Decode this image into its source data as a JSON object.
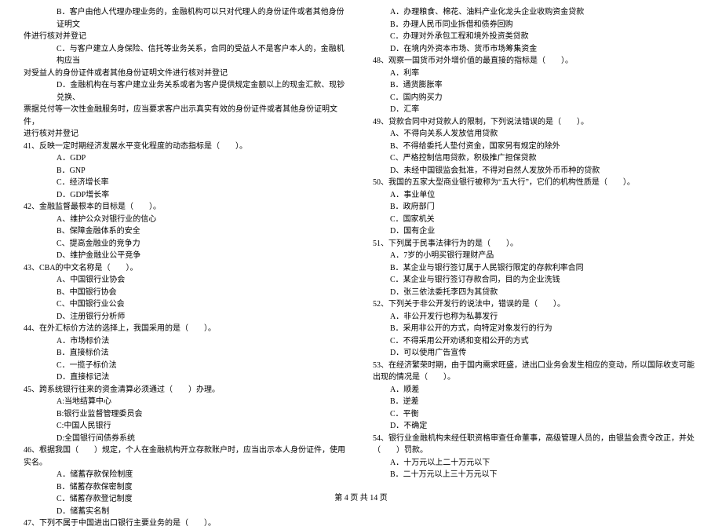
{
  "left": [
    {
      "cls": "i2",
      "t": "B．客户由他人代理办理业务的，金融机构可以只对代理人的身份证件或者其他身份证明文"
    },
    {
      "cls": "i0",
      "t": "件进行核对并登记"
    },
    {
      "cls": "i2",
      "t": "C．与客户建立人身保险、信托等业务关系，合同的受益人不是客户本人的，金融机构应当"
    },
    {
      "cls": "i0",
      "t": "对受益人的身份证件或者其他身份证明文件进行核对并登记"
    },
    {
      "cls": "i2",
      "t": "D．金融机构在与客户建立业务关系或者为客户提供规定金额以上的现金汇款、现钞兑换、"
    },
    {
      "cls": "i0",
      "t": "票据兑付等一次性金融服务时，应当要求客户出示真实有效的身份证件或者其他身份证明文件，"
    },
    {
      "cls": "i0",
      "t": "进行核对并登记"
    },
    {
      "cls": "i0",
      "t": "41、反映一定时期经济发展水平变化程度的动态指标是（　　）。"
    },
    {
      "cls": "i2",
      "t": "A．GDP"
    },
    {
      "cls": "i2",
      "t": "B．GNP"
    },
    {
      "cls": "i2",
      "t": "C．经济增长率"
    },
    {
      "cls": "i2",
      "t": "D．GDP增长率"
    },
    {
      "cls": "i0",
      "t": "42、金融监督最根本的目标是（　　）。"
    },
    {
      "cls": "i2",
      "t": "A、维护公众对银行业的信心"
    },
    {
      "cls": "i2",
      "t": "B、保障金融体系的安全"
    },
    {
      "cls": "i2",
      "t": "C、提高金融业的竞争力"
    },
    {
      "cls": "i2",
      "t": "D、维护金融业公平竞争"
    },
    {
      "cls": "i0",
      "t": "43、CBA的中文名称是（　　）。"
    },
    {
      "cls": "i2",
      "t": "A、中国银行业协会"
    },
    {
      "cls": "i2",
      "t": "B、中国银行协会"
    },
    {
      "cls": "i2",
      "t": "C、中国银行业公会"
    },
    {
      "cls": "i2",
      "t": "D、注册银行分析师"
    },
    {
      "cls": "i0",
      "t": "44、在外汇标价方法的选择上，我国采用的是（　　）。"
    },
    {
      "cls": "i2",
      "t": "A．市场标价法"
    },
    {
      "cls": "i2",
      "t": "B．直接标价法"
    },
    {
      "cls": "i2",
      "t": "C．一揽子标价法"
    },
    {
      "cls": "i2",
      "t": "D．直接标记法"
    },
    {
      "cls": "i0",
      "t": "45、跨系统银行往来的资金清算必须通过（　　）办理。"
    },
    {
      "cls": "i2",
      "t": "A:当地结算中心"
    },
    {
      "cls": "i2",
      "t": "B:银行业监督管理委员会"
    },
    {
      "cls": "i2",
      "t": "C:中国人民银行"
    },
    {
      "cls": "i2",
      "t": "D:全国银行间债券系统"
    },
    {
      "cls": "i0",
      "t": "46、根据我国（　　）规定，个人在金融机构开立存款账户时，应当出示本人身份证件，使用"
    },
    {
      "cls": "i0",
      "t": "实名。"
    },
    {
      "cls": "i2",
      "t": "A．储蓄存款保险制度"
    },
    {
      "cls": "i2",
      "t": "B．储蓄存款保密制度"
    },
    {
      "cls": "i2",
      "t": "C．储蓄存款登记制度"
    },
    {
      "cls": "i2",
      "t": "D．储蓄实名制"
    },
    {
      "cls": "i0",
      "t": "47、下列不属于中国进出口银行主要业务的是（　　）。"
    }
  ],
  "right": [
    {
      "cls": "i1",
      "t": "A．办理粮食、棉花、油料产业化龙头企业收购资金贷款"
    },
    {
      "cls": "i1",
      "t": "B．办理人民币同业拆借和债券回购"
    },
    {
      "cls": "i1",
      "t": "C．办理对外承包工程和境外投资类贷款"
    },
    {
      "cls": "i1",
      "t": "D．在境内外资本市场、货币市场筹集资金"
    },
    {
      "cls": "i0",
      "t": "48、观察一国货币对外增价值的最直接的指标是（　　）。"
    },
    {
      "cls": "i1",
      "t": "A．利率"
    },
    {
      "cls": "i1",
      "t": "B．通货膨胀率"
    },
    {
      "cls": "i1",
      "t": "C．国内购买力"
    },
    {
      "cls": "i1",
      "t": "D．汇率"
    },
    {
      "cls": "i0",
      "t": "49、贷款合同中对贷款人的限制，下列说法错误的是（　　）。"
    },
    {
      "cls": "i1",
      "t": "A、不得向关系人发放信用贷款"
    },
    {
      "cls": "i1",
      "t": "B、不得给委托人垫付资金，国家另有规定的除外"
    },
    {
      "cls": "i1",
      "t": "C、严格控制信用贷款，积极推广担保贷款"
    },
    {
      "cls": "i1",
      "t": "D、未经中国银监会批准，不得对自然人发放外币币种的贷款"
    },
    {
      "cls": "i0",
      "t": "50、我国的五家大型商业银行被称为“五大行”，它们的机构性质是（　　）。"
    },
    {
      "cls": "i1",
      "t": "A．事业单位"
    },
    {
      "cls": "i1",
      "t": "B．政府部门"
    },
    {
      "cls": "i1",
      "t": "C．国家机关"
    },
    {
      "cls": "i1",
      "t": "D．国有企业"
    },
    {
      "cls": "i0",
      "t": "51、下列属于民事法律行为的是（　　）。"
    },
    {
      "cls": "i1",
      "t": "A．7岁的小明买银行理财产品"
    },
    {
      "cls": "i1",
      "t": "B．某企业与银行签订属于人民银行限定的存款利率合同"
    },
    {
      "cls": "i1",
      "t": "C．某企业与银行签订存款合同，目的为企业洗钱"
    },
    {
      "cls": "i1",
      "t": "D．张三依法委托李四为其贷款"
    },
    {
      "cls": "i0",
      "t": "52、下列关于非公开发行的说法中，错误的是（　　）。"
    },
    {
      "cls": "i1",
      "t": "A．非公开发行也称为私募发行"
    },
    {
      "cls": "i1",
      "t": "B．采用非公开的方式，向特定对象发行的行为"
    },
    {
      "cls": "i1",
      "t": "C．不得采用公开劝诱和变相公开的方式"
    },
    {
      "cls": "i1",
      "t": "D．可以使用广告宣传"
    },
    {
      "cls": "i0",
      "t": "53、在经济繁荣时期，由于国内需求旺盛，进出口业务会发生相应的变动，所以国际收支可能"
    },
    {
      "cls": "i0",
      "t": "出现的情况是（　　）。"
    },
    {
      "cls": "i1",
      "t": "A．顺差"
    },
    {
      "cls": "i1",
      "t": "B．逆差"
    },
    {
      "cls": "i1",
      "t": "C．平衡"
    },
    {
      "cls": "i1",
      "t": "D．不确定"
    },
    {
      "cls": "i0",
      "t": "54、银行业金融机构未经任职资格审查任命董事，高级管理人员的，由银监会责令改正，并处"
    },
    {
      "cls": "i0",
      "t": "（　　）罚款。"
    },
    {
      "cls": "i1",
      "t": "A．十万元以上二十万元以下"
    },
    {
      "cls": "i1",
      "t": "B．二十万元以上三十万元以下"
    }
  ],
  "footer": "第 4 页 共 14 页"
}
